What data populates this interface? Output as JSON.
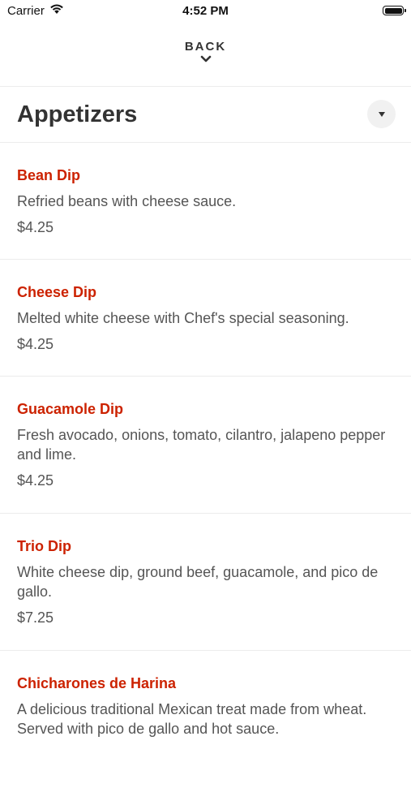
{
  "status_bar": {
    "carrier": "Carrier",
    "time": "4:52 PM"
  },
  "nav": {
    "back_label": "BACK"
  },
  "category": {
    "title": "Appetizers"
  },
  "menu_items": [
    {
      "name": "Bean Dip",
      "description": "Refried beans with cheese sauce.",
      "price": "$4.25"
    },
    {
      "name": "Cheese Dip",
      "description": "Melted white cheese with Chef's special seasoning.",
      "price": "$4.25"
    },
    {
      "name": "Guacamole Dip",
      "description": "Fresh avocado, onions, tomato, cilantro, jalapeno pepper and lime.",
      "price": "$4.25"
    },
    {
      "name": "Trio Dip",
      "description": "White cheese dip, ground beef, guacamole, and pico de gallo.",
      "price": "$7.25"
    },
    {
      "name": "Chicharones de Harina",
      "description": "A delicious traditional Mexican treat made from wheat. Served with pico de gallo and hot sauce.",
      "price": ""
    }
  ],
  "colors": {
    "item_name": "#cc2200",
    "text": "#555555",
    "heading": "#333333"
  }
}
